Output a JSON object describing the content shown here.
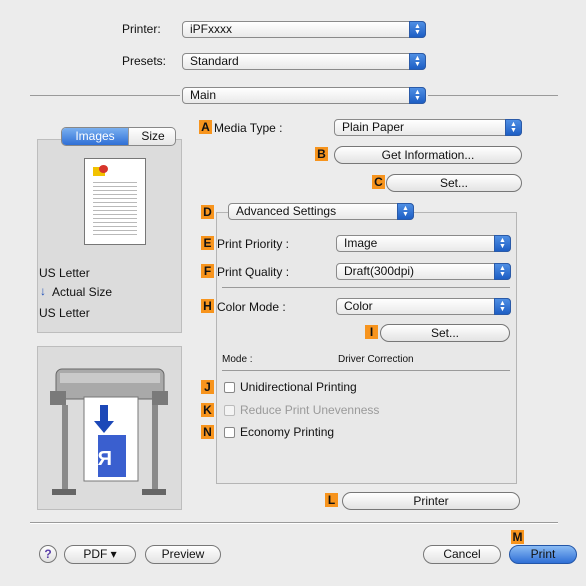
{
  "top": {
    "printer_label": "Printer:",
    "printer_value": "iPFxxxx",
    "presets_label": "Presets:",
    "presets_value": "Standard",
    "panel_value": "Main"
  },
  "preview": {
    "tab_images": "Images",
    "tab_size": "Size",
    "paper_size": "US Letter",
    "actual_size": "Actual Size",
    "output_size": "US Letter"
  },
  "tags": {
    "A": "A",
    "B": "B",
    "C": "C",
    "D": "D",
    "E": "E",
    "F": "F",
    "H": "H",
    "I": "I",
    "J": "J",
    "K": "K",
    "N": "N",
    "L": "L",
    "M": "M"
  },
  "main": {
    "media_type_label": "Media Type :",
    "media_type_value": "Plain Paper",
    "get_info_button": "Get Information...",
    "set_button": "Set...",
    "advanced_settings": "Advanced Settings",
    "print_priority_label": "Print Priority :",
    "print_priority_value": "Image",
    "print_quality_label": "Print Quality :",
    "print_quality_value": "Draft(300dpi)",
    "color_mode_label": "Color Mode :",
    "color_mode_value": "Color",
    "color_set_button": "Set...",
    "mode_label": "Mode :",
    "mode_value": "Driver Correction",
    "unidirectional": "Unidirectional Printing",
    "reduce_unevenness": "Reduce Print Unevenness",
    "economy": "Economy Printing",
    "printer_button": "Printer"
  },
  "bottom": {
    "help": "?",
    "pdf_button": "PDF ▾",
    "preview_button": "Preview",
    "cancel_button": "Cancel",
    "print_button": "Print"
  },
  "colors": {
    "tag": "#f7941d",
    "accent": "#2f6fd6",
    "printer_blue": "#2a55c8"
  }
}
